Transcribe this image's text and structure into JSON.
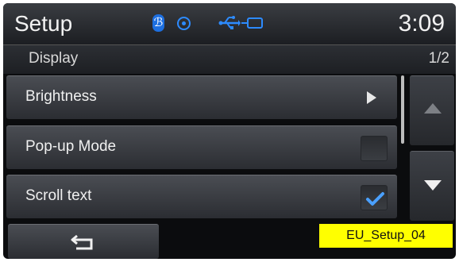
{
  "status_bar": {
    "title": "Setup",
    "time": "3:09",
    "icons": [
      "bluetooth-icon",
      "disc-icon",
      "usb-icon",
      "plug-icon"
    ]
  },
  "section": {
    "title": "Display",
    "page": "1/2"
  },
  "menu": {
    "items": [
      {
        "label": "Brightness",
        "control": "arrow"
      },
      {
        "label": "Pop-up Mode",
        "control": "checkbox",
        "checked": false
      },
      {
        "label": "Scroll text",
        "control": "checkbox",
        "checked": true
      }
    ]
  },
  "scroll": {
    "up_enabled": false,
    "down_enabled": true
  },
  "watermark": "EU_Setup_04",
  "colors": {
    "accent_blue": "#2d8bff",
    "checkmark_blue": "#4aa0ff",
    "watermark_yellow": "#ffff00"
  }
}
